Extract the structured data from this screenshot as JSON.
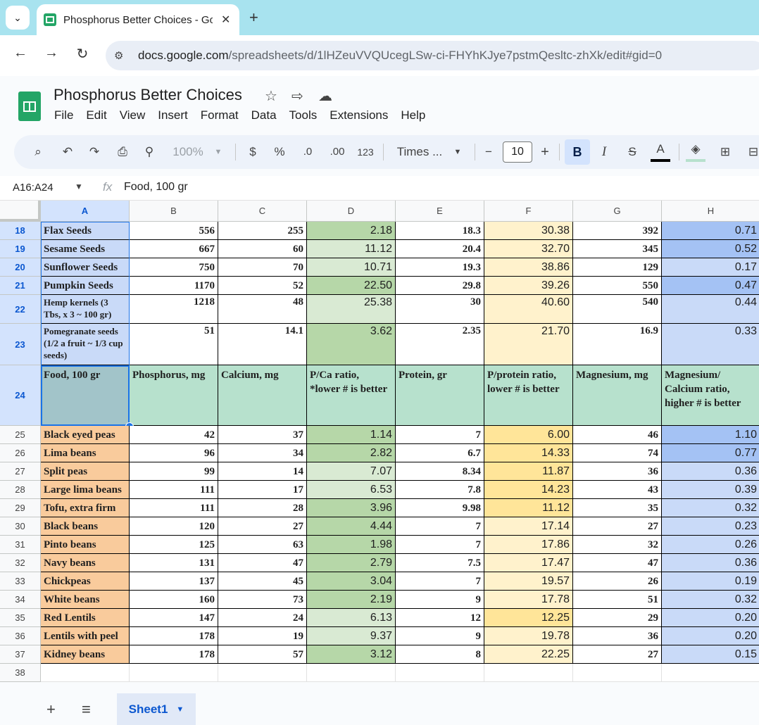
{
  "browser": {
    "tab_title": "Phosphorus Better Choices - Go",
    "new_tab": "+",
    "url_host": "docs.google.com",
    "url_path": "/spreadsheets/d/1lHZeuVVQUcegLSw-ci-FHYhKJye7pstmQesltc-zhXk/edit#gid=0"
  },
  "doc": {
    "title": "Phosphorus Better Choices",
    "menu": [
      "File",
      "Edit",
      "View",
      "Insert",
      "Format",
      "Data",
      "Tools",
      "Extensions",
      "Help"
    ]
  },
  "toolbar": {
    "zoom": "100%",
    "currency": "$",
    "percent": "%",
    "dec_decrease": ".0",
    "dec_increase": ".00",
    "number_format": "123",
    "font": "Times ...",
    "font_size": "10",
    "minus": "−",
    "plus": "+",
    "bold": "B",
    "italic": "I",
    "text_color": "A"
  },
  "formula_bar": {
    "name_box": "A16:A24",
    "fx": "fx",
    "value": "Food, 100 gr"
  },
  "columns": [
    "A",
    "B",
    "C",
    "D",
    "E",
    "F",
    "G",
    "H"
  ],
  "rows_top": [
    {
      "row": "18",
      "food": "Flax Seeds",
      "b": "556",
      "c": "255",
      "d": "2.18",
      "e": "18.3",
      "f": "30.38",
      "g": "392",
      "h": "0.71"
    },
    {
      "row": "19",
      "food": "Sesame Seeds",
      "b": "667",
      "c": "60",
      "d": "11.12",
      "e": "20.4",
      "f": "32.70",
      "g": "345",
      "h": "0.52"
    },
    {
      "row": "20",
      "food": "Sunflower Seeds",
      "b": "750",
      "c": "70",
      "d": "10.71",
      "e": "19.3",
      "f": "38.86",
      "g": "129",
      "h": "0.17"
    },
    {
      "row": "21",
      "food": "Pumpkin Seeds",
      "b": "1170",
      "c": "52",
      "d": "22.50",
      "e": "29.8",
      "f": "39.26",
      "g": "550",
      "h": "0.47"
    },
    {
      "row": "22",
      "food": "Hemp kernels (3 Tbs, x 3 ~ 100 gr)",
      "b": "1218",
      "c": "48",
      "d": "25.38",
      "e": "30",
      "f": "40.60",
      "g": "540",
      "h": "0.44"
    },
    {
      "row": "23",
      "food": "Pomegranate seeds (1/2 a fruit ~ 1/3 cup seeds)",
      "b": "51",
      "c": "14.1",
      "d": "3.62",
      "e": "2.35",
      "f": "21.70",
      "g": "16.9",
      "h": "0.33"
    }
  ],
  "header_row": {
    "row": "24",
    "a": "Food, 100 gr",
    "b": "Phosphorus, mg",
    "c": "Calcium, mg",
    "d": "P/Ca ratio, *lower # is better",
    "e": "Protein, gr",
    "f": "P/protein ratio, lower # is better",
    "g": "Magnesium, mg",
    "h": "Magnesium/ Calcium ratio, higher # is better"
  },
  "rows_bottom": [
    {
      "row": "25",
      "food": "Black eyed peas",
      "b": "42",
      "c": "37",
      "d": "1.14",
      "e": "7",
      "f": "6.00",
      "g": "46",
      "h": "1.10"
    },
    {
      "row": "26",
      "food": "Lima beans",
      "b": "96",
      "c": "34",
      "d": "2.82",
      "e": "6.7",
      "f": "14.33",
      "g": "74",
      "h": "0.77"
    },
    {
      "row": "27",
      "food": "Split peas",
      "b": "99",
      "c": "14",
      "d": "7.07",
      "e": "8.34",
      "f": "11.87",
      "g": "36",
      "h": "0.36"
    },
    {
      "row": "28",
      "food": "Large lima beans",
      "b": "111",
      "c": "17",
      "d": "6.53",
      "e": "7.8",
      "f": "14.23",
      "g": "43",
      "h": "0.39"
    },
    {
      "row": "29",
      "food": "Tofu, extra firm",
      "b": "111",
      "c": "28",
      "d": "3.96",
      "e": "9.98",
      "f": "11.12",
      "g": "35",
      "h": "0.32"
    },
    {
      "row": "30",
      "food": "Black beans",
      "b": "120",
      "c": "27",
      "d": "4.44",
      "e": "7",
      "f": "17.14",
      "g": "27",
      "h": "0.23"
    },
    {
      "row": "31",
      "food": "Pinto beans",
      "b": "125",
      "c": "63",
      "d": "1.98",
      "e": "7",
      "f": "17.86",
      "g": "32",
      "h": "0.26"
    },
    {
      "row": "32",
      "food": "Navy beans",
      "b": "131",
      "c": "47",
      "d": "2.79",
      "e": "7.5",
      "f": "17.47",
      "g": "47",
      "h": "0.36"
    },
    {
      "row": "33",
      "food": "Chickpeas",
      "b": "137",
      "c": "45",
      "d": "3.04",
      "e": "7",
      "f": "19.57",
      "g": "26",
      "h": "0.19"
    },
    {
      "row": "34",
      "food": "White beans",
      "b": "160",
      "c": "73",
      "d": "2.19",
      "e": "9",
      "f": "17.78",
      "g": "51",
      "h": "0.32"
    },
    {
      "row": "35",
      "food": "Red Lentils",
      "b": "147",
      "c": "24",
      "d": "6.13",
      "e": "12",
      "f": "12.25",
      "g": "29",
      "h": "0.20"
    },
    {
      "row": "36",
      "food": "Lentils with peel",
      "b": "178",
      "c": "19",
      "d": "9.37",
      "e": "9",
      "f": "19.78",
      "g": "36",
      "h": "0.20"
    },
    {
      "row": "37",
      "food": "Kidney beans",
      "b": "178",
      "c": "57",
      "d": "3.12",
      "e": "8",
      "f": "22.25",
      "g": "27",
      "h": "0.15"
    }
  ],
  "empty_row": "38",
  "sheets": {
    "add": "+",
    "list": "≡",
    "active": "Sheet1"
  },
  "colors": {
    "food_top": "#c9daf8",
    "food_bottom": "#f9cb9c",
    "header_row": "#b7e1cd",
    "header_food": "#a2c4c9",
    "d_dark": "#b6d7a8",
    "d_light": "#d9ead3",
    "f_light": "#fff2cc",
    "f_dark": "#ffe599",
    "h_dark": "#a4c2f4",
    "h_light": "#c9daf8"
  }
}
